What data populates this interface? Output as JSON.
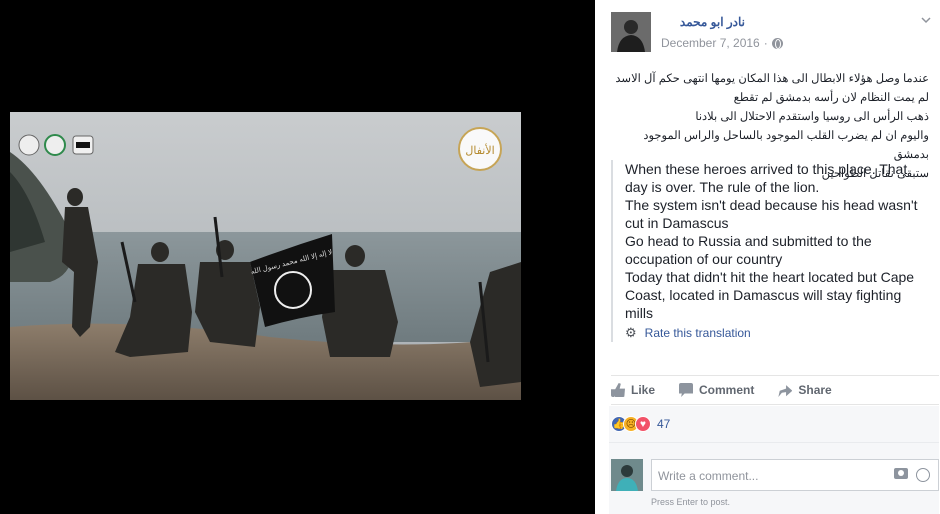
{
  "post": {
    "author": "نادر ابو محمد",
    "date": "December 7, 2016",
    "separator": "·",
    "arabic_lines": [
      "عندما وصل هؤلاء الابطال الى هذا المكان يومها انتهى حكم آل الاسد",
      "لم يمت النظام لان رأسه بدمشق لم تقطع",
      "ذهب الرأس الى روسيا واستقدم الاحتلال الى بلادنا",
      "واليوم ان لم يضرب القلب الموجود بالساحل والراس الموجود بدمشق",
      "ستبقى نقاتل الطواحين"
    ],
    "translation_lines": [
      "When these heroes arrived to this place. That day is over. The rule of the lion.",
      "The system isn't dead because his head wasn't cut in Damascus",
      "Go head to Russia and submitted to the occupation of our country",
      "Today that didn't hit the heart located but Cape Coast, located in Damascus will stay fighting mills"
    ],
    "rate_translation": "Rate this translation",
    "photo_logo_text": "الأنفال",
    "photo_banner_text": "لا إله إلا الله محمد رسول الله"
  },
  "actions": {
    "like": "Like",
    "comment": "Comment",
    "share": "Share"
  },
  "reactions": {
    "icons": [
      "like-icon",
      "sad-icon",
      "love-icon"
    ],
    "count": "47"
  },
  "composer": {
    "placeholder": "Write a comment...",
    "hint": "Press Enter to post."
  },
  "colors": {
    "link": "#365899",
    "text": "#1d2129",
    "muted": "#90949c"
  }
}
